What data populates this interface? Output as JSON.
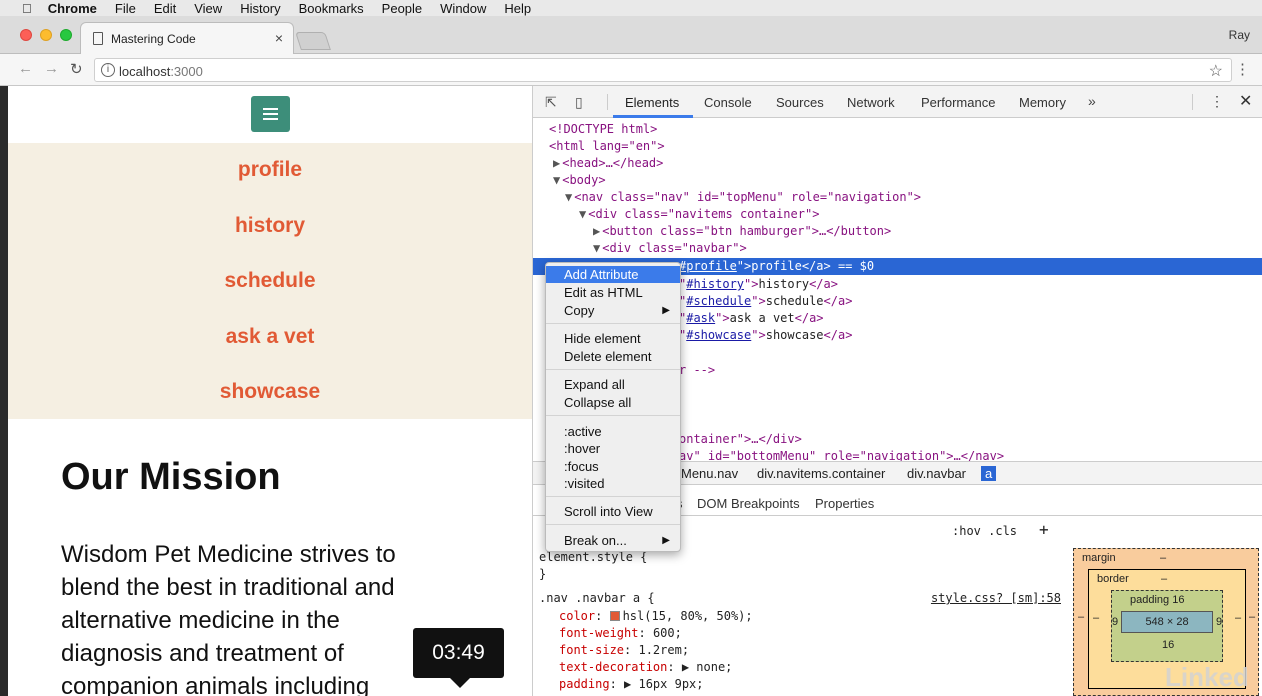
{
  "menubar": {
    "items": [
      "Chrome",
      "File",
      "Edit",
      "View",
      "History",
      "Bookmarks",
      "People",
      "Window",
      "Help"
    ]
  },
  "tab": {
    "title": "Mastering Code",
    "close": "×"
  },
  "profile_name": "Ray",
  "address": {
    "host": "localhost",
    "port": ":3000"
  },
  "page": {
    "nav_links": [
      "profile",
      "history",
      "schedule",
      "ask a vet",
      "showcase"
    ],
    "mission_title": "Our Mission",
    "mission_lines": [
      "Wisdom Pet Medicine strives to",
      "blend the best in traditional and",
      "alternative medicine in the",
      "diagnosis and treatment of",
      "companion animals including"
    ],
    "accent_color": "#e15a35",
    "nav_bg": "#f5efe2",
    "hamburger_color": "#3d8e7a"
  },
  "video_timestamp": "03:49",
  "devtools": {
    "tabs": [
      "Elements",
      "Console",
      "Sources",
      "Network",
      "Performance",
      "Memory"
    ],
    "more": "»",
    "dom": {
      "doctype": "<!DOCTYPE html>",
      "html_open": "<html lang=\"en\">",
      "head": "<head>…</head>",
      "body": "<body>",
      "nav": "<nav class=\"nav\" id=\"topMenu\" role=\"navigation\">",
      "div_container": "<div class=\"navitems container\">",
      "button": "<button class=\"btn hamburger\">…</button>",
      "div_navbar": "<div class=\"navbar\">",
      "sel_href": "#profile",
      "sel_text": "profile",
      "sel_suffix": "== $0",
      "link_history_href": "#history",
      "link_history_text": "history",
      "link_schedule_href": "#schedule",
      "link_schedule_text": "schedule",
      "link_ask_href": "#ask",
      "link_ask_text": "ask a vet",
      "link_showcase_href": "#showcase",
      "link_showcase_text": "showcase",
      "comment_tail": "r -->",
      "container_tail": "ontainer\">…</div>",
      "bottom_tail": "av\" id=\"bottomMenu\" role=\"navigation\">…</nav>"
    },
    "breadcrumb": [
      "Menu.nav",
      "div.navitems.container",
      "div.navbar",
      "a"
    ],
    "subtabs": [
      "s",
      "DOM Breakpoints",
      "Properties"
    ],
    "styles": {
      "hov_cls": ":hov  .cls",
      "plus": "+",
      "element_style": "element.style {",
      "close_brace": "}",
      "rule_selector": ".nav .navbar a {",
      "rule_source": "style.css? [sm]:58",
      "decls": [
        {
          "prop": "color",
          "value": "hsl(15, 80%, 50%);"
        },
        {
          "prop": "font-weight",
          "value": "600;"
        },
        {
          "prop": "font-size",
          "value": "1.2rem;"
        },
        {
          "prop": "text-decoration",
          "value": "▶ none;"
        },
        {
          "prop": "padding",
          "value": "▶ 16px 9px;"
        }
      ]
    },
    "box_model": {
      "margin_label": "margin",
      "margin_value": "–",
      "border_label": "border",
      "border_value": "–",
      "padding_label": "padding 16",
      "padding_bottom": "16",
      "padding_side": "9",
      "content": "548 × 28",
      "outer_dash": "–"
    }
  },
  "context_menu": {
    "items": [
      "Add Attribute",
      "Edit as HTML",
      "Copy",
      "Hide element",
      "Delete element",
      "Expand all",
      "Collapse all",
      ":active",
      ":hover",
      ":focus",
      ":visited",
      "Scroll into View",
      "Break on..."
    ]
  },
  "watermark": "Linked in"
}
